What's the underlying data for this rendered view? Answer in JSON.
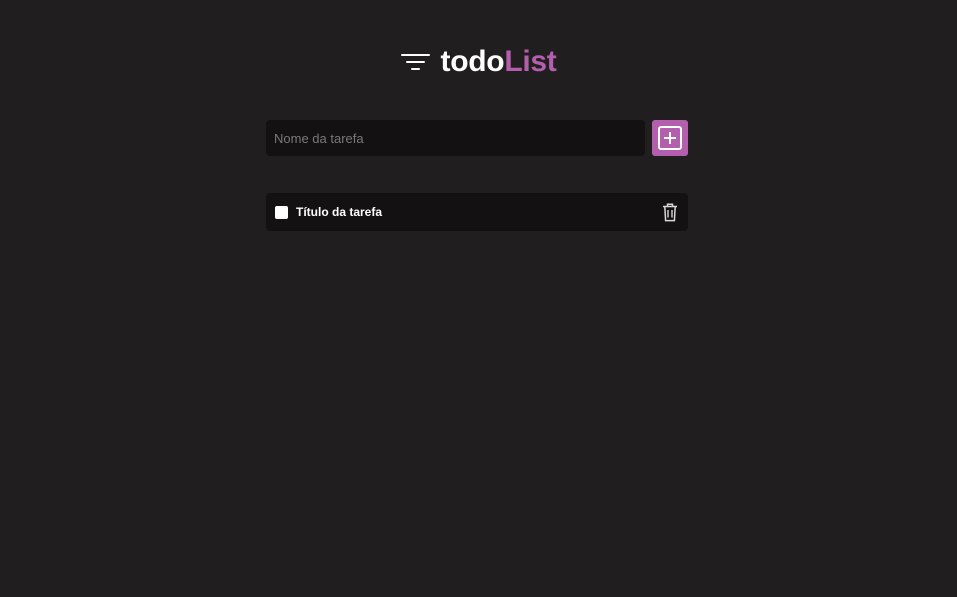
{
  "header": {
    "icon": "filter-lines-icon",
    "title_main": "todo",
    "title_accent": "List",
    "accent_color": "#b45fad"
  },
  "form": {
    "input_value": "",
    "input_placeholder": "Nome da tarefa",
    "add_button_icon": "plus-square-icon"
  },
  "tasks": [
    {
      "title": "Título da tarefa",
      "checked": false,
      "delete_icon": "trash-icon"
    }
  ],
  "colors": {
    "background": "#201e1f",
    "surface": "#131112",
    "accent": "#b45fad",
    "text": "#ffffff",
    "placeholder": "#7b7879"
  }
}
